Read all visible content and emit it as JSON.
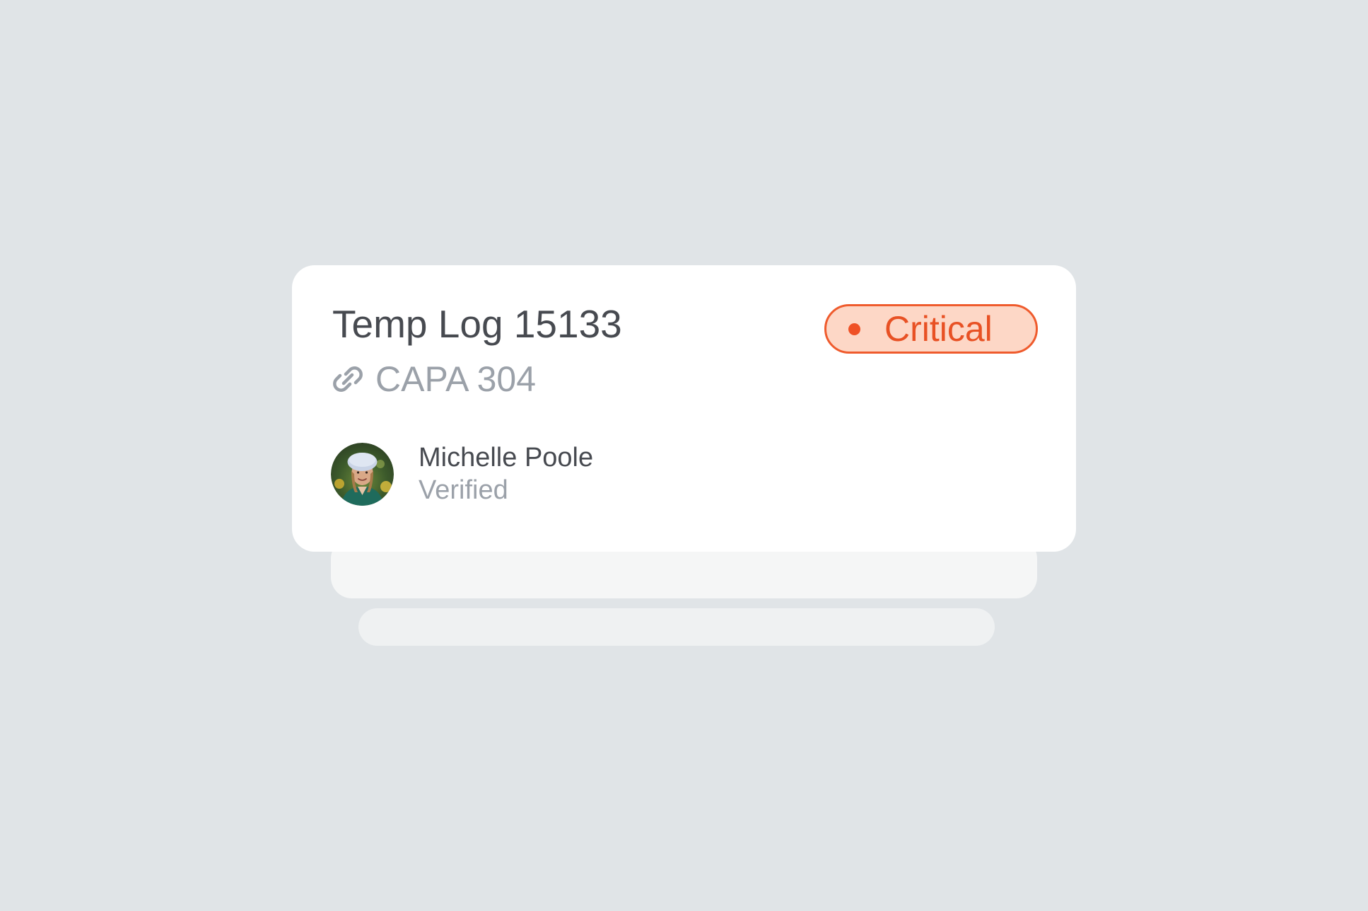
{
  "record": {
    "title": "Temp Log 15133",
    "linked": {
      "icon": "link-icon",
      "label": "CAPA 304"
    },
    "severity": {
      "label": "Critical",
      "color": "#ef5b2d",
      "background": "#fdd7c6"
    },
    "person": {
      "name": "Michelle Poole",
      "status": "Verified",
      "avatar_icon": "avatar"
    }
  },
  "colors": {
    "page_background": "#e0e4e7",
    "card_background": "#ffffff",
    "title_text": "#474a50",
    "muted_text": "#9ba1a9"
  }
}
